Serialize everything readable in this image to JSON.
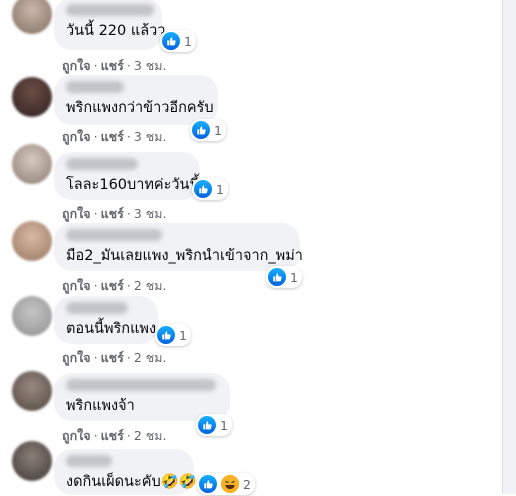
{
  "colors": {
    "bubble": "#f0f2f5",
    "meta": "#65676b",
    "like": "#1877f2"
  },
  "actions": {
    "like": "ถูกใจ",
    "share": "แชร์",
    "dot": "·"
  },
  "comments": [
    {
      "text": "วันนี้ 220 แล้วว",
      "reactions_count": "1",
      "reactions": [
        "like-icon"
      ],
      "time": "3 ชม."
    },
    {
      "text": "พริกแพงกว่าข้าวอีกครับ",
      "reactions_count": "1",
      "reactions": [
        "like-icon"
      ],
      "time": "3 ชม."
    },
    {
      "text": "โลละ160บาทค่ะวันนี้",
      "reactions_count": "1",
      "reactions": [
        "like-icon"
      ],
      "time": "3 ชม."
    },
    {
      "text": "มือ2_มันเลยแพง_พริกนำเข้าจาก_พม่า",
      "reactions_count": "1",
      "reactions": [
        "like-icon"
      ],
      "time": "2 ชม."
    },
    {
      "text": "ตอนนี้พริกแพง",
      "reactions_count": "1",
      "reactions": [
        "like-icon"
      ],
      "time": "2 ชม."
    },
    {
      "text": "พริกแพงจ้า",
      "reactions_count": "1",
      "reactions": [
        "like-icon"
      ],
      "time": "2 ชม."
    },
    {
      "text": "งดกินเผ็ดนะคับ🤣🤣",
      "reactions_count": "2",
      "reactions": [
        "like-icon",
        "laugh-icon"
      ],
      "time": ""
    }
  ]
}
